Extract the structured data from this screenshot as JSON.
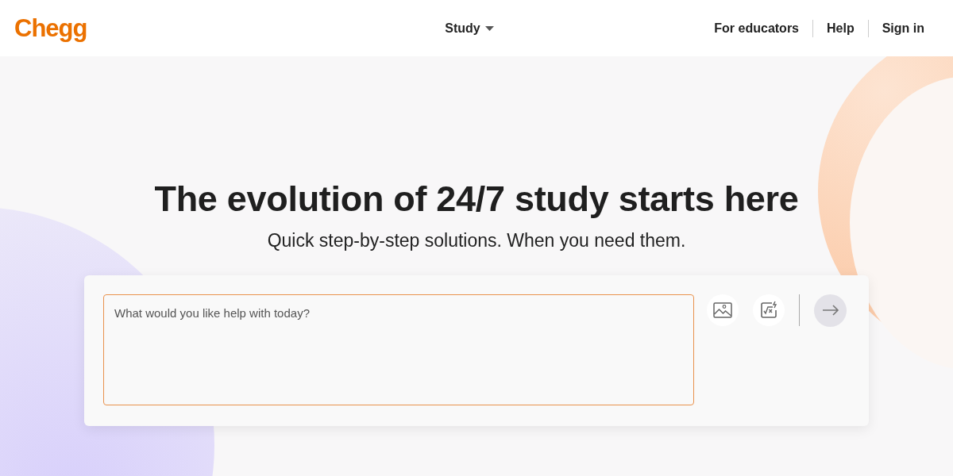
{
  "header": {
    "logo": "Chegg",
    "menu": {
      "label": "Study",
      "kind": "dropdown"
    },
    "links": [
      "For educators",
      "Help",
      "Sign in"
    ]
  },
  "hero": {
    "title": "The evolution of 24/7 study starts here",
    "subtitle": "Quick step-by-step solutions. When you need them."
  },
  "ask": {
    "placeholder": "What would you like help with today?",
    "submit_disabled": true
  }
}
